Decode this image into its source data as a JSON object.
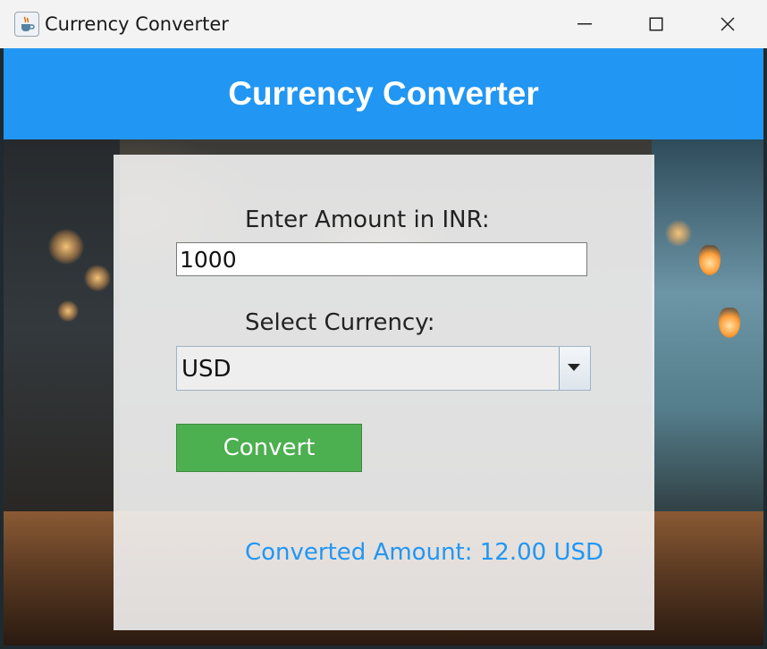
{
  "window": {
    "title": "Currency Converter",
    "icon": "java-cup-icon"
  },
  "header": {
    "title": "Currency Converter",
    "color": "#2196f3"
  },
  "form": {
    "amount_label": "Enter Amount in INR:",
    "amount_value": "1000",
    "currency_label": "Select Currency:",
    "currency_selected": "USD",
    "convert_label": "Convert",
    "convert_color": "#4caf50",
    "result_text": "Converted Amount: 12.00 USD",
    "result_color": "#2196f3"
  }
}
